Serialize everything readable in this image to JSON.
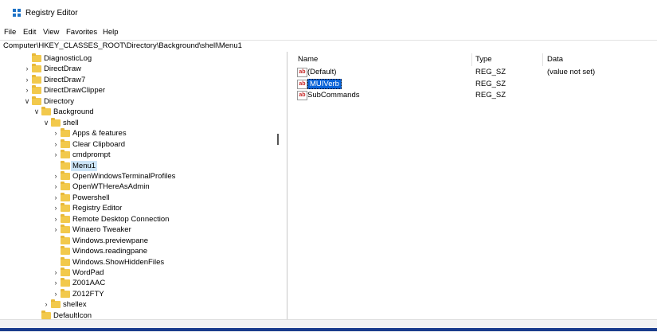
{
  "window": {
    "title": "Registry Editor"
  },
  "menu": [
    "File",
    "Edit",
    "View",
    "Favorites",
    "Help"
  ],
  "address": "Computer\\HKEY_CLASSES_ROOT\\Directory\\Background\\shell\\Menu1",
  "tree": [
    {
      "label": "DiagnosticLog",
      "chevron": "",
      "indent": 0
    },
    {
      "label": "DirectDraw",
      "chevron": ">",
      "indent": 0
    },
    {
      "label": "DirectDraw7",
      "chevron": ">",
      "indent": 0
    },
    {
      "label": "DirectDrawClipper",
      "chevron": ">",
      "indent": 0
    },
    {
      "label": "Directory",
      "chevron": "v",
      "indent": 0
    },
    {
      "label": "Background",
      "chevron": "v",
      "indent": 1
    },
    {
      "label": "shell",
      "chevron": "v",
      "indent": 2
    },
    {
      "label": "Apps & features",
      "chevron": ">",
      "indent": 3
    },
    {
      "label": "Clear Clipboard",
      "chevron": ">",
      "indent": 3
    },
    {
      "label": "cmdprompt",
      "chevron": ">",
      "indent": 3
    },
    {
      "label": "Menu1",
      "chevron": "",
      "indent": 3,
      "selected": true
    },
    {
      "label": "OpenWindowsTerminalProfiles",
      "chevron": ">",
      "indent": 3
    },
    {
      "label": "OpenWTHereAsAdmin",
      "chevron": ">",
      "indent": 3
    },
    {
      "label": "Powershell",
      "chevron": ">",
      "indent": 3
    },
    {
      "label": "Registry Editor",
      "chevron": ">",
      "indent": 3
    },
    {
      "label": "Remote Desktop Connection",
      "chevron": ">",
      "indent": 3
    },
    {
      "label": "Winaero Tweaker",
      "chevron": ">",
      "indent": 3
    },
    {
      "label": "Windows.previewpane",
      "chevron": "",
      "indent": 3
    },
    {
      "label": "Windows.readingpane",
      "chevron": "",
      "indent": 3
    },
    {
      "label": "Windows.ShowHiddenFiles",
      "chevron": "",
      "indent": 3
    },
    {
      "label": "WordPad",
      "chevron": ">",
      "indent": 3
    },
    {
      "label": "Z001AAC",
      "chevron": ">",
      "indent": 3
    },
    {
      "label": "Z012FTY",
      "chevron": ">",
      "indent": 3
    },
    {
      "label": "shellex",
      "chevron": ">",
      "indent": 2
    },
    {
      "label": "DefaultIcon",
      "chevron": "",
      "indent": 1
    }
  ],
  "columns": {
    "name": "Name",
    "type": "Type",
    "data": "Data"
  },
  "values": [
    {
      "name": "(Default)",
      "type": "REG_SZ",
      "data": "(value not set)",
      "icon": "ab"
    },
    {
      "name": "MUIVerb",
      "type": "REG_SZ",
      "data": "",
      "icon": "ab",
      "selected": true
    },
    {
      "name": "SubCommands",
      "type": "REG_SZ",
      "data": "",
      "icon": "ab"
    }
  ],
  "colors": {
    "selection": "#0a64d8",
    "tree_selection": "#cce4f7",
    "folder": "#f2c94c"
  }
}
